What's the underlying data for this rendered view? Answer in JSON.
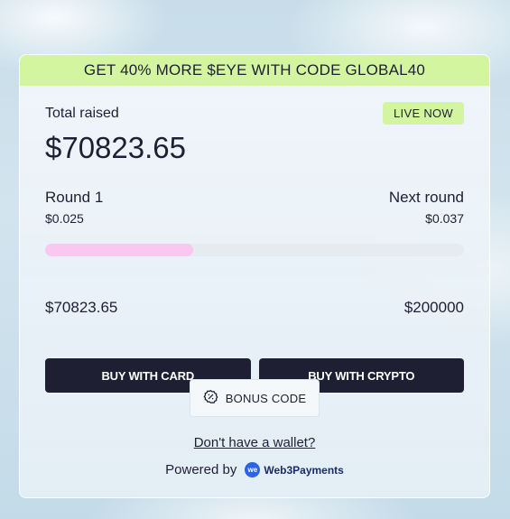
{
  "promo": {
    "text": "GET 40% MORE $EYE WITH CODE GLOBAL40"
  },
  "total": {
    "label": "Total raised",
    "value": "$70823.65",
    "badge": "LIVE NOW"
  },
  "rounds": {
    "current_label": "Round 1",
    "current_price": "$0.025",
    "next_label": "Next round",
    "next_price": "$0.037"
  },
  "progress": {
    "fraction": 0.354,
    "raised": "$70823.65",
    "goal": "$200000",
    "fill_color": "#f9c7ef"
  },
  "actions": {
    "buy_card": "BUY WITH CARD",
    "buy_crypto": "BUY WITH CRYPTO",
    "bonus_code": "BONUS CODE",
    "bonus_icon": "discount-badge-icon"
  },
  "footer": {
    "wallet_link": "Don't have a wallet?",
    "powered_by": "Powered by",
    "brand_name": "Web3Payments",
    "brand_icon": "web3payments-logo"
  },
  "colors": {
    "accent_green": "#d4f5a0",
    "dark_button": "#1e1f33",
    "brand_blue": "#2e63e6"
  }
}
